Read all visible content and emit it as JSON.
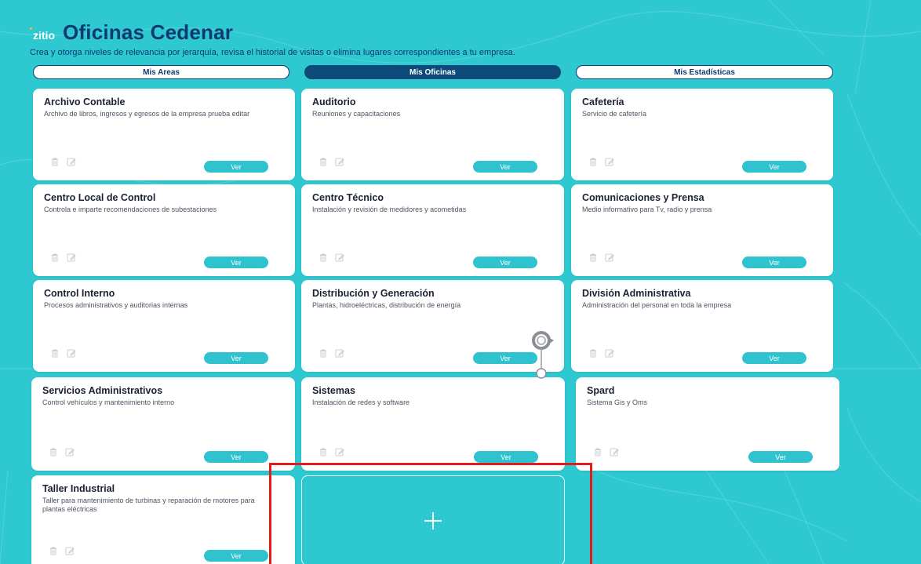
{
  "brand": "zitio",
  "page_title": "Oficinas Cedenar",
  "subtitle": "Crea y otorga niveles de relevancia por jerarquía, revisa el historial de visitas o elimina lugares correspondientes a tu empresa.",
  "tabs": [
    {
      "label": "Mis Areas",
      "active": false
    },
    {
      "label": "Mis Oficinas",
      "active": true
    },
    {
      "label": "Mis Estadísticas",
      "active": false
    }
  ],
  "cards": [
    {
      "title": "Archivo Contable",
      "description": "Archivo de libros, ingresos y egresos de la empresa prueba editar",
      "button": "Ver"
    },
    {
      "title": "Auditorio",
      "description": "Reuniones y capacitaciones",
      "button": "Ver"
    },
    {
      "title": "Cafetería",
      "description": "Servicio de cafetería",
      "button": "Ver"
    },
    {
      "title": "Centro Local de Control",
      "description": "Controla e imparte recomendaciones de subestaciones",
      "button": "Ver"
    },
    {
      "title": "Centro Técnico",
      "description": "Instalación y revisión de medidores y acometidas",
      "button": "Ver"
    },
    {
      "title": "Comunicaciones y Prensa",
      "description": "Medio informativo para Tv, radio y prensa",
      "button": "Ver"
    },
    {
      "title": "Control Interno",
      "description": "Procesos administrativos y auditorias internas",
      "button": "Ver"
    },
    {
      "title": "Distribución y Generación",
      "description": "Plantas, hidroeléctricas, distribución de energía",
      "button": "Ver"
    },
    {
      "title": "División Administrativa",
      "description": "Administración del personal en toda la empresa",
      "button": "Ver"
    },
    {
      "title": "Servicios Administrativos",
      "description": "Control vehículos y mantenimiento interno",
      "button": "Ver"
    },
    {
      "title": "Sistemas",
      "description": "Instalación de redes y software",
      "button": "Ver"
    },
    {
      "title": "Spard",
      "description": "Sistema Gis y Oms",
      "button": "Ver"
    },
    {
      "title": "Taller Industrial",
      "description": "Taller para mantenimiento de turbinas y reparación de motores para plantas eléctricas",
      "button": "Ver"
    }
  ],
  "add_card": {
    "icon": "plus-icon"
  },
  "colors": {
    "background": "#2ec8d0",
    "title": "#0e3a73",
    "active_tab": "#0d4a7a",
    "ver_button": "#2ec3cf",
    "highlight": "#e21b1b"
  }
}
